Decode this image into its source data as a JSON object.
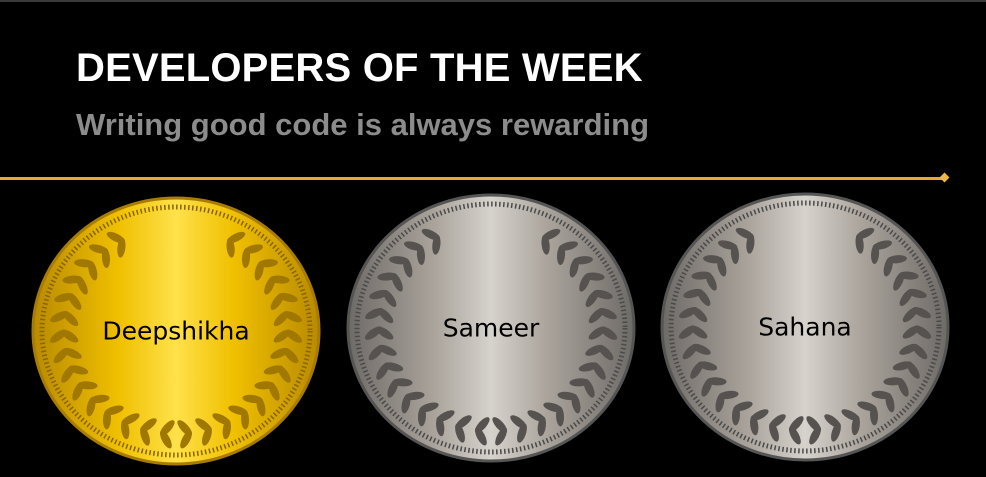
{
  "header": {
    "title": "DEVELOPERS OF THE WEEK",
    "subtitle": "Writing good code is always rewarding"
  },
  "medals": [
    {
      "name": "Deepshikha",
      "tier": "gold"
    },
    {
      "name": "Sameer",
      "tier": "silver"
    },
    {
      "name": "Sahana",
      "tier": "silver"
    }
  ],
  "colors": {
    "background": "#000000",
    "accent_line": "#e8a83a",
    "gold": "#f2c200",
    "silver": "#b9b4ae"
  }
}
